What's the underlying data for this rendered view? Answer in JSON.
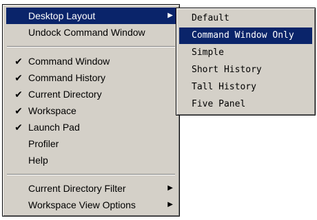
{
  "main_menu": {
    "items": [
      {
        "label": "Desktop Layout",
        "checked": false,
        "has_submenu": true,
        "highlighted": true
      },
      {
        "label": "Undock Command Window",
        "checked": false,
        "has_submenu": false
      },
      {
        "label": "Command Window",
        "checked": true,
        "has_submenu": false
      },
      {
        "label": "Command History",
        "checked": true,
        "has_submenu": false
      },
      {
        "label": "Current Directory",
        "checked": true,
        "has_submenu": false
      },
      {
        "label": "Workspace",
        "checked": true,
        "has_submenu": false
      },
      {
        "label": "Launch Pad",
        "checked": true,
        "has_submenu": false
      },
      {
        "label": "Profiler",
        "checked": false,
        "has_submenu": false
      },
      {
        "label": "Help",
        "checked": false,
        "has_submenu": false
      },
      {
        "label": "Current Directory Filter",
        "checked": false,
        "has_submenu": true
      },
      {
        "label": "Workspace View Options",
        "checked": false,
        "has_submenu": true
      }
    ],
    "check_glyph": "✔",
    "submenu_arrow_glyph": "▶"
  },
  "desktop_layout_submenu": {
    "items": [
      {
        "label": "Default",
        "highlighted": false
      },
      {
        "label": "Command Window Only",
        "highlighted": true
      },
      {
        "label": "Simple",
        "highlighted": false
      },
      {
        "label": "Short History",
        "highlighted": false
      },
      {
        "label": "Tall History",
        "highlighted": false
      },
      {
        "label": "Five Panel",
        "highlighted": false
      }
    ]
  },
  "colors": {
    "menu_background": "#d4d0c8",
    "highlight_background": "#0a246a",
    "highlight_text": "#ffffff",
    "text": "#000000"
  }
}
